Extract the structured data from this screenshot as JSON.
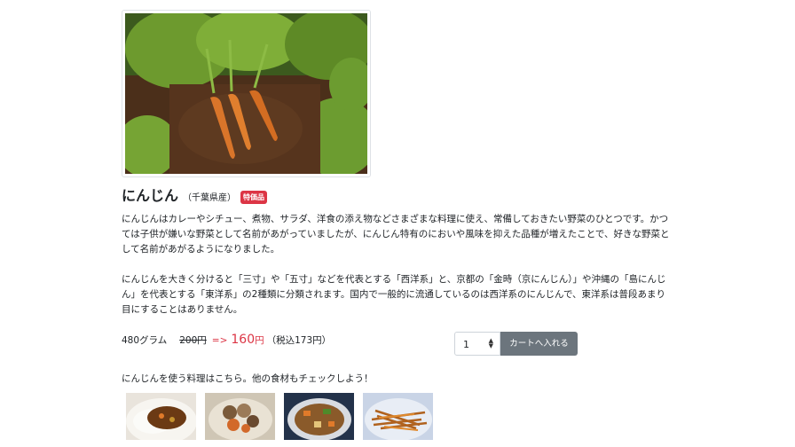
{
  "product": {
    "name": "にんじん",
    "origin": "（千葉県産）",
    "badge": "特価品",
    "image": "carrot-field-photo",
    "description": [
      "にんじんはカレーやシチュー、煮物、サラダ、洋食の添え物などさまざまな料理に使え、常備しておきたい野菜のひとつです。かつては子供が嫌いな野菜として名前があがっていましたが、にんじん特有のにおいや風味を抑えた品種が増えたことで、好きな野菜として名前があがるようになりました。",
      "にんじんを大きく分けると「三寸」や「五寸」などを代表とする「西洋系」と、京都の「金時（京にんじん）」や沖縄の「島にんじん」を代表とする「東洋系」の2種類に分類されます。国内で一般的に流通しているのは西洋系のにんじんで、東洋系は普段あまり目にすることはありません。"
    ]
  },
  "pricing": {
    "weight": "480グラム",
    "original_price": "200円",
    "arrow": "=>",
    "sale_price": "160",
    "sale_unit": "円",
    "tax_note": "（税込173円）"
  },
  "cart": {
    "quantity": "1",
    "button_label": "カートへ入れる"
  },
  "recipes": {
    "heading": "にんじんを使う料理はこちら。他の食材もチェックしよう！",
    "thumbnails": [
      "curry-rice-photo",
      "nimono-photo",
      "stewed-vegetables-photo",
      "kinpira-photo"
    ]
  },
  "colors": {
    "accent": "#dc3545",
    "button": "#6c757d"
  }
}
